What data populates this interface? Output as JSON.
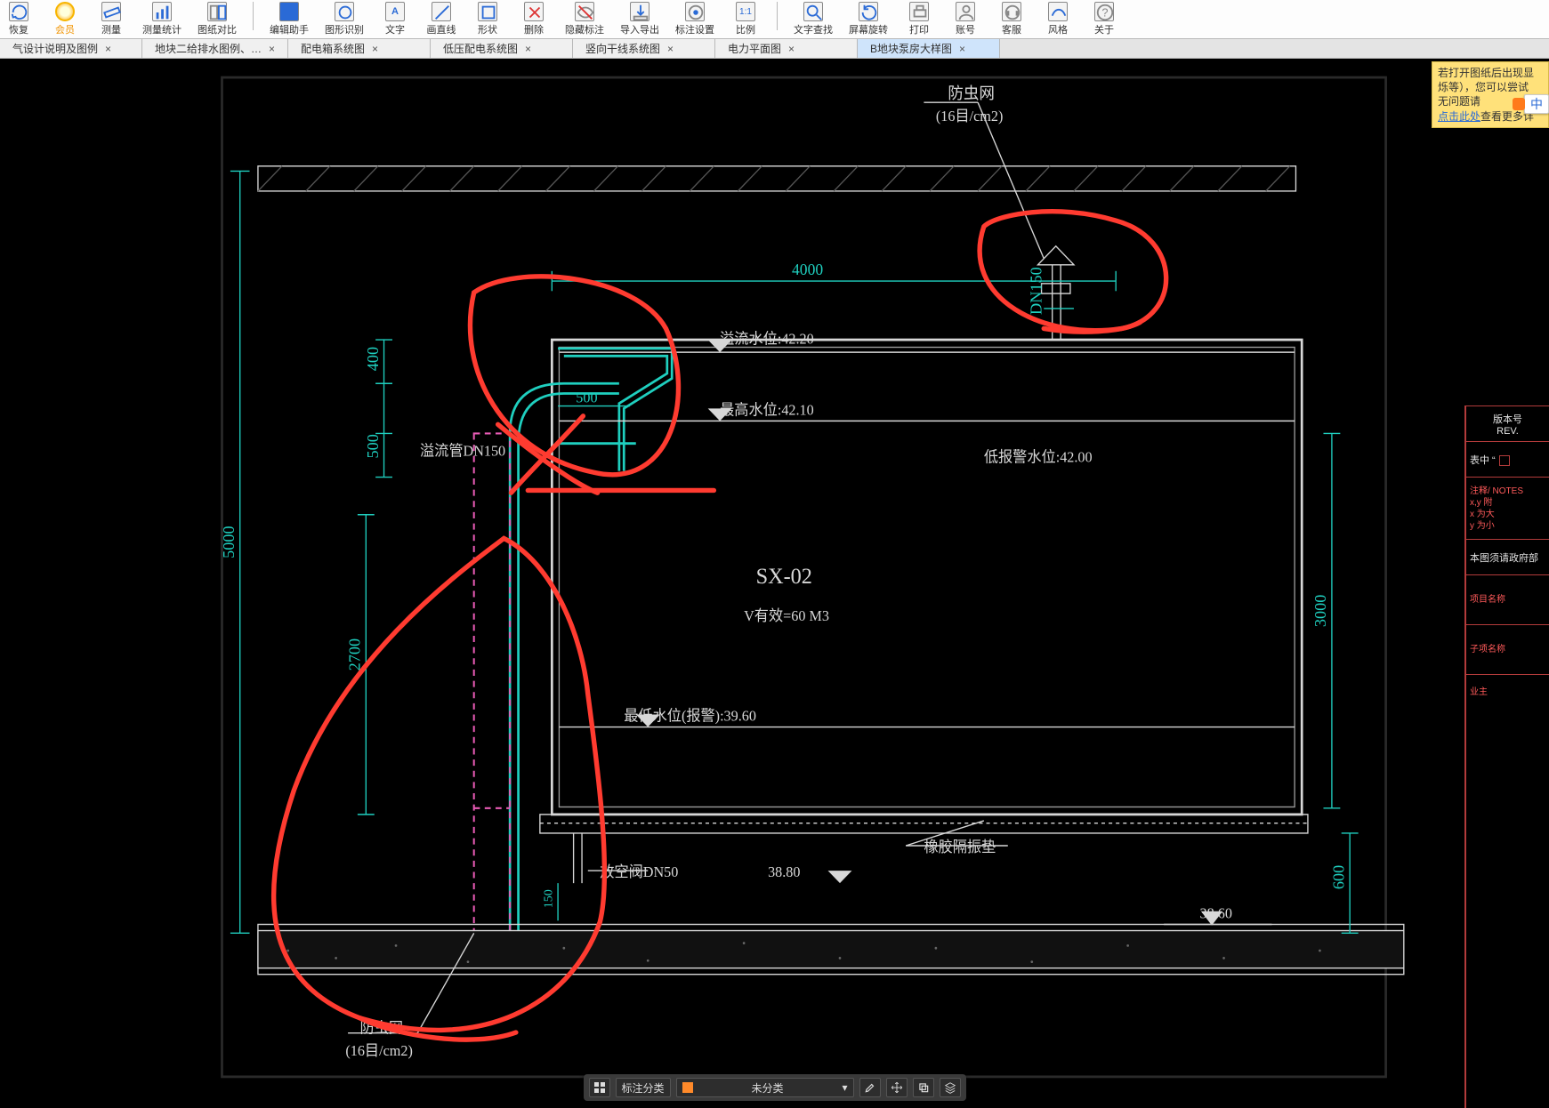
{
  "toolbar": {
    "items": [
      {
        "id": "restore",
        "label": "恢复"
      },
      {
        "id": "vip",
        "label": "会员"
      },
      {
        "id": "measure",
        "label": "测量"
      },
      {
        "id": "measure-stats",
        "label": "测量统计"
      },
      {
        "id": "compare",
        "label": "图纸对比"
      },
      {
        "id": "edit-assist",
        "label": "编辑助手"
      },
      {
        "id": "shape-rec",
        "label": "图形识别"
      },
      {
        "id": "text",
        "label": "文字"
      },
      {
        "id": "draw-line",
        "label": "画直线"
      },
      {
        "id": "shape",
        "label": "形状"
      },
      {
        "id": "delete",
        "label": "删除"
      },
      {
        "id": "hide-annot",
        "label": "隐藏标注"
      },
      {
        "id": "import-export",
        "label": "导入导出"
      },
      {
        "id": "annot-settings",
        "label": "标注设置"
      },
      {
        "id": "scale",
        "label": "比例"
      },
      {
        "id": "find-text",
        "label": "文字查找"
      },
      {
        "id": "rotate",
        "label": "屏幕旋转"
      },
      {
        "id": "print",
        "label": "打印"
      },
      {
        "id": "account",
        "label": "账号"
      },
      {
        "id": "support",
        "label": "客服"
      },
      {
        "id": "style",
        "label": "风格"
      },
      {
        "id": "about",
        "label": "关于"
      }
    ]
  },
  "tabs": [
    {
      "id": "tab1",
      "label": "气设计说明及图例",
      "active": false
    },
    {
      "id": "tab2",
      "label": "地块二给排水图例、…",
      "active": false
    },
    {
      "id": "tab3",
      "label": "配电箱系统图",
      "active": false
    },
    {
      "id": "tab4",
      "label": "低压配电系统图",
      "active": false
    },
    {
      "id": "tab5",
      "label": "竖向干线系统图",
      "active": false
    },
    {
      "id": "tab6",
      "label": "电力平面图",
      "active": false
    },
    {
      "id": "tab7",
      "label": "B地块泵房大样图",
      "active": true
    }
  ],
  "note": {
    "line1": "若打开图纸后出现显",
    "line2": "烁等），您可以尝试",
    "line3_prefix": "无问题请",
    "link": "点击此处",
    "line3_suffix": "查看更多详"
  },
  "ime": {
    "char": "中"
  },
  "drawing": {
    "top_label": "防虫网",
    "top_spec": "(16目/cm2)",
    "dim_4000": "4000",
    "dim_DN150": "DN150",
    "dim_5000": "5000",
    "dim_400": "400",
    "dim_500a": "500",
    "dim_500b": "500",
    "overflow_pipe": "溢流管DN150",
    "overflow_level": "溢流水位:42.20",
    "high_level": "最高水位:42.10",
    "low_alarm_level": "低报警水位:42.00",
    "tank_id": "SX-02",
    "tank_vol": "V有效=60 M3",
    "dim_2700": "2700",
    "min_level": "最低水位(报警):39.60",
    "dim_3000": "3000",
    "rubber_pad": "橡胶隔振垫",
    "drain_valve": "放空阀DN50",
    "elev_3880": "38.80",
    "elev_3860": "38.60",
    "dim_600": "600",
    "dim_150": "150",
    "bottom_label": "防虫网",
    "bottom_spec": "(16目/cm2)"
  },
  "titleblock": {
    "rev_cn": "版本号",
    "rev_en": "REV.",
    "star_label": "表中 “",
    "notes_header": "注释/ NOTES",
    "note_xy": "x,y 附",
    "note_x": "x 为大",
    "note_y": "y 为小",
    "gov_line": "本图须请政府部",
    "proj_name": "项目名称",
    "sub_proj": "子项名称",
    "owner": "业主"
  },
  "floatbar": {
    "label_category": "标注分类",
    "dropdown_value": "未分类"
  }
}
